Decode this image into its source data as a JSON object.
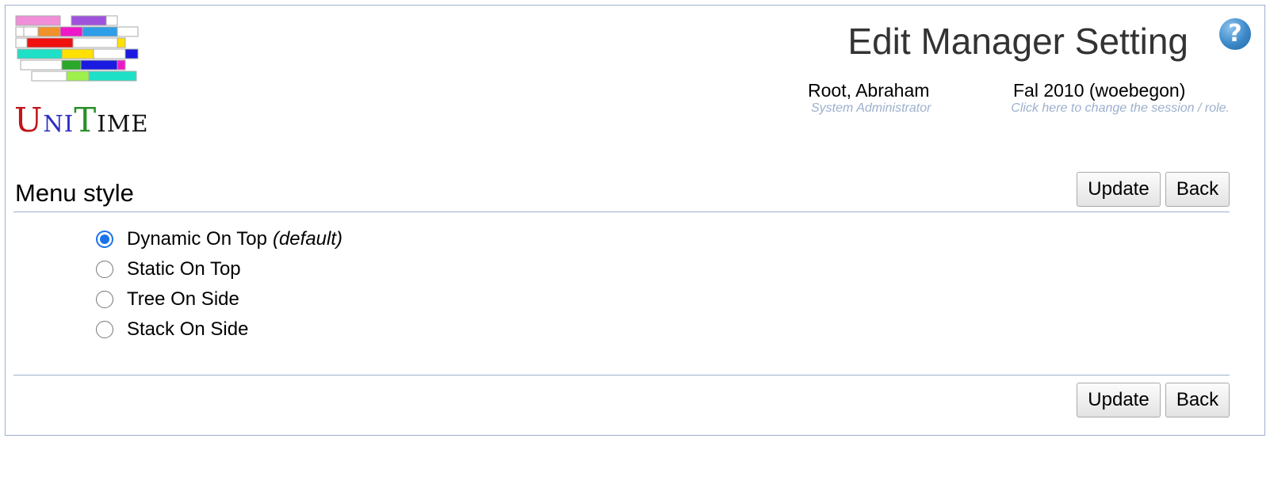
{
  "header": {
    "logo": {
      "letters": [
        "U",
        "NI",
        "T",
        "IME"
      ],
      "colors": [
        "#c0161b",
        "#2d2ec4",
        "#2a8f2a",
        "#111111"
      ]
    },
    "title": "Edit Manager Setting",
    "help_icon": "help-icon",
    "user": {
      "name": "Root, Abraham",
      "role": "System Administrator"
    },
    "session": {
      "name": "Fal 2010 (woebegon)",
      "hint": "Click here to change the session / role."
    }
  },
  "section": {
    "title": "Menu style",
    "update_label": "Update",
    "back_label": "Back"
  },
  "menu_style_options": [
    {
      "label": "Dynamic On Top",
      "suffix": "(default)",
      "checked": true
    },
    {
      "label": "Static On Top",
      "suffix": "",
      "checked": false
    },
    {
      "label": "Tree On Side",
      "suffix": "",
      "checked": false
    },
    {
      "label": "Stack On Side",
      "suffix": "",
      "checked": false
    }
  ],
  "footer": {
    "update_label": "Update",
    "back_label": "Back"
  },
  "colors": {
    "accent": "#9cb0ce",
    "radio_checked": "#1a73e8",
    "title_text": "#333333"
  }
}
